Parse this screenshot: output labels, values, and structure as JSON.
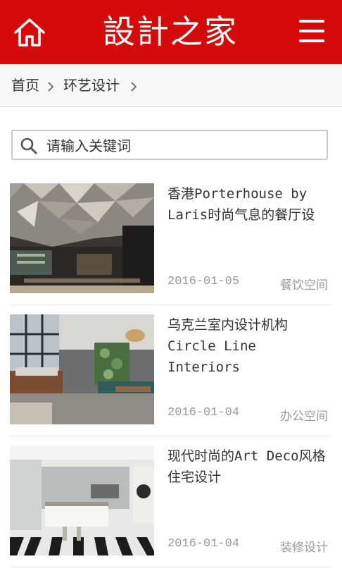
{
  "header": {
    "logo_text": "設計之家",
    "home_icon": "home-icon",
    "menu_icon": "menu-icon",
    "background": "#d50b0b"
  },
  "breadcrumb": {
    "home": "首页",
    "section": "环艺设计"
  },
  "search": {
    "placeholder": "请输入关键词"
  },
  "articles": [
    {
      "title": "香港Porterhouse by Laris时尚气息的餐厅设",
      "date": "2016-01-05",
      "category": "餐饮空间"
    },
    {
      "title": "乌克兰室内设计机构 Circle Line Interiors",
      "date": "2016-01-04",
      "category": "办公空间"
    },
    {
      "title": "现代时尚的Art Deco风格住宅设计",
      "date": "2016-01-04",
      "category": "装修设计"
    }
  ]
}
